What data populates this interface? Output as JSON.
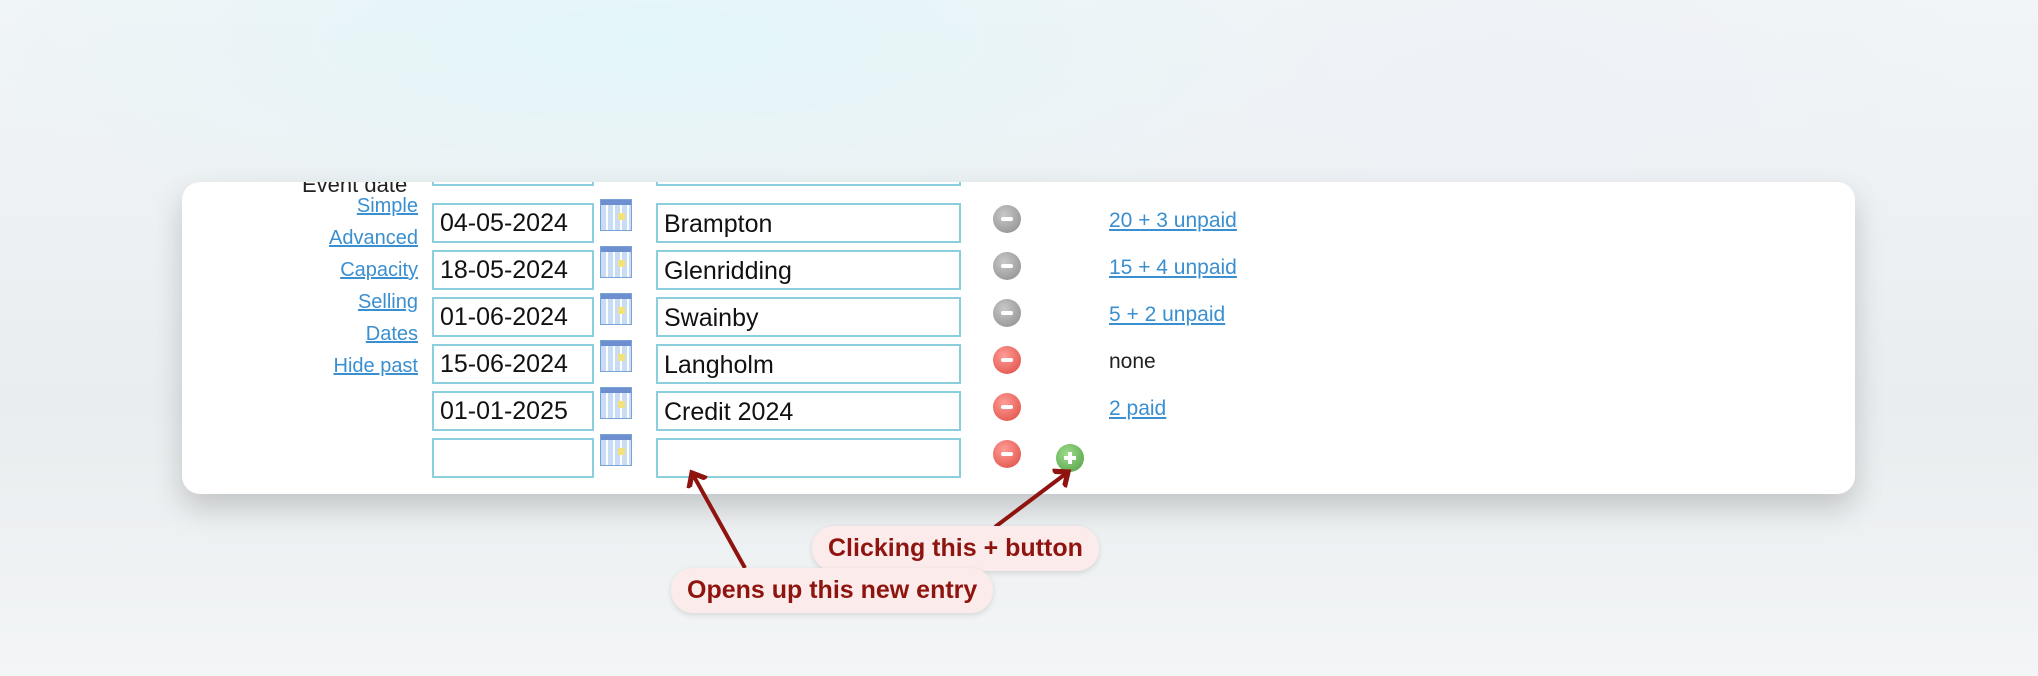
{
  "section_label": "Event date",
  "side_links": [
    "Simple",
    "Advanced",
    "Capacity",
    "Selling",
    "Dates",
    "Hide past"
  ],
  "rows": [
    {
      "date": "04-05-2024",
      "name": "Brampton",
      "remove_color": "grey",
      "status": "20 + 3 unpaid",
      "status_is_link": true
    },
    {
      "date": "18-05-2024",
      "name": "Glenridding",
      "remove_color": "grey",
      "status": "15 + 4 unpaid",
      "status_is_link": true
    },
    {
      "date": "01-06-2024",
      "name": "Swainby",
      "remove_color": "grey",
      "status": "5 + 2 unpaid",
      "status_is_link": true
    },
    {
      "date": "15-06-2024",
      "name": "Langholm",
      "remove_color": "red",
      "status": "none",
      "status_is_link": false
    },
    {
      "date": "01-01-2025",
      "name": "Credit 2024",
      "remove_color": "red",
      "status": "2 paid",
      "status_is_link": true
    },
    {
      "date": "",
      "name": "",
      "remove_color": "red",
      "status": "",
      "status_is_link": false
    }
  ],
  "annotations": {
    "callout_plus": "Clicking this + button",
    "callout_entry": "Opens up this new entry",
    "color": "#8f1410"
  }
}
